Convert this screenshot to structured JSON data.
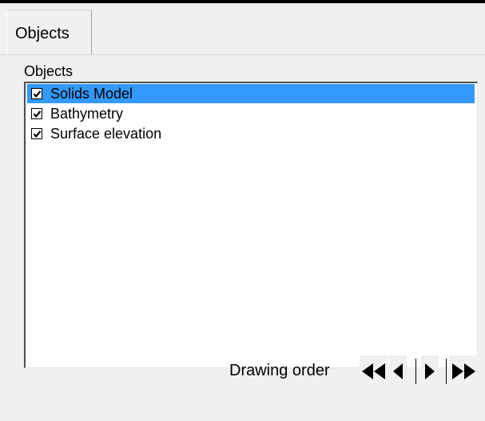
{
  "tab": {
    "label": "Objects"
  },
  "group": {
    "label": "Objects"
  },
  "objects": [
    {
      "label": "Solids Model",
      "checked": true,
      "selected": true
    },
    {
      "label": "Bathymetry",
      "checked": true,
      "selected": false
    },
    {
      "label": "Surface elevation",
      "checked": true,
      "selected": false
    }
  ],
  "drawing_order": {
    "label": "Drawing order",
    "buttons": [
      {
        "name": "move-to-back",
        "icon": "double-left-arrow-icon"
      },
      {
        "name": "move-backward",
        "icon": "left-arrow-icon"
      },
      {
        "name": "move-forward",
        "icon": "right-arrow-icon"
      },
      {
        "name": "move-to-front",
        "icon": "double-right-arrow-icon"
      }
    ]
  },
  "colors": {
    "selection": "#3399ff",
    "background": "#f0f0f0",
    "list_background": "#ffffff"
  }
}
